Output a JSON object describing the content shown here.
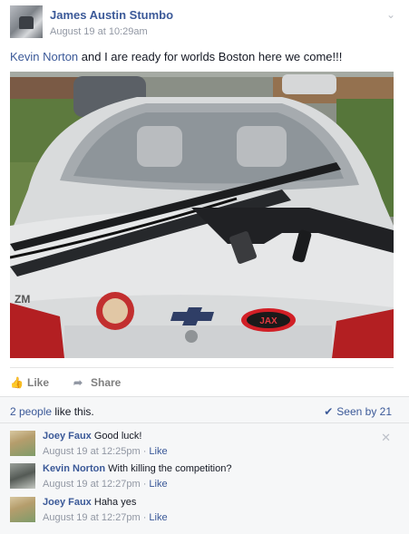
{
  "post": {
    "author": "James Austin Stumbo",
    "timestamp": "August 19 at 10:29am",
    "mention": "Kevin Norton",
    "text": " and I are ready for worlds Boston here we come!!!",
    "photo_stickers": {
      "left": "NATIONAL RIFLE ASSOCIATION",
      "right": "JAX",
      "badge": "ZM"
    }
  },
  "actions": {
    "like": "Like",
    "share": "Share"
  },
  "ufi": {
    "likes_link": "2 people",
    "likes_suffix": " like this.",
    "seen": "Seen by 21"
  },
  "comments": [
    {
      "author": "Joey Faux",
      "text": "Good luck!",
      "time": "August 19 at 12:25pm",
      "like": "Like",
      "avatar": "joey-avatar"
    },
    {
      "author": "Kevin Norton",
      "text": "With killing the competition?",
      "time": "August 19 at 12:27pm",
      "like": "Like",
      "avatar": "kevin-avatar"
    },
    {
      "author": "Joey Faux",
      "text": "Haha yes",
      "time": "August 19 at 12:27pm",
      "like": "Like",
      "avatar": "joey-avatar"
    }
  ],
  "colors": {
    "link": "#3b5998",
    "meta": "#9197a3",
    "ufi_bg": "#f6f7f8"
  }
}
